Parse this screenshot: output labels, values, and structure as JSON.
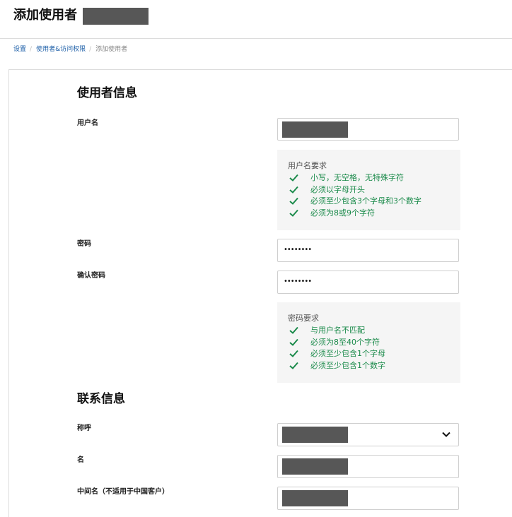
{
  "header": {
    "title": "添加使用者"
  },
  "breadcrumb": {
    "items": [
      {
        "label": "设置"
      },
      {
        "label": "使用者&访问权限"
      }
    ],
    "current": "添加使用者",
    "separator": "/"
  },
  "user_info": {
    "heading": "使用者信息",
    "username_label": "用户名",
    "username_requirements": {
      "title": "用户名要求",
      "items": [
        "小写，无空格，无特殊字符",
        "必须以字母开头",
        "必须至少包含3个字母和3个数字",
        "必须为8或9个字符"
      ]
    },
    "password_label": "密码",
    "password_value": "••••••••",
    "confirm_password_label": "确认密码",
    "confirm_password_value": "••••••••",
    "password_requirements": {
      "title": "密码要求",
      "items": [
        "与用户名不匹配",
        "必须为8至40个字符",
        "必须至少包含1个字母",
        "必须至少包含1个数字"
      ]
    }
  },
  "contact_info": {
    "heading": "联系信息",
    "salutation_label": "称呼",
    "first_name_label": "名",
    "middle_name_label": "中间名（不适用于中国客户）"
  },
  "colors": {
    "link": "#1d5fa8",
    "check_green": "#1a8a4a",
    "redaction": "#575757",
    "requirement_bg": "#f5f5f5"
  },
  "icons": {
    "requirement_check": "check-icon",
    "select_arrow": "chevron-down-icon"
  }
}
